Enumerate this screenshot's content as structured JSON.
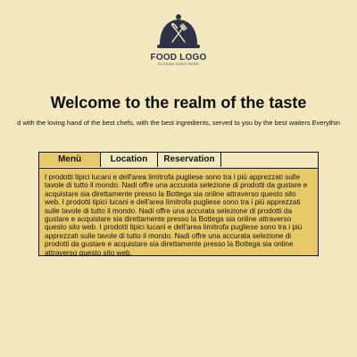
{
  "logo": {
    "title": "FOOD LOGO",
    "slogan": "SLOGAN GOES HERE",
    "icon": "cloche-fork-knife-icon",
    "color": "#2d3248"
  },
  "header": {
    "title": "Welcome to the realm of the taste",
    "tagline": "d with the loving hand of the best chefs, with the best ingredients, served to you by the best waiters Everythin"
  },
  "tabs": [
    {
      "label": "Menù",
      "active": true
    },
    {
      "label": "Location",
      "active": false
    },
    {
      "label": "Reservation",
      "active": false
    }
  ],
  "content": {
    "text": "I prodotti tipici lucani e dell'area limitrofa pugliese sono tra i più apprezzati sulle tavole di tutto il mondo. Nadi offre una accurata selezione di prodotti da gustare e acquistare sia direttamente presso la Bottega sia online attraverso questo sito web. I prodotti tipici lucani e dell'area limitrofa pugliese sono tra i più apprezzati sulle tavole di tutto il mondo. Nadi offre una accurata selezione di prodotti da gustare e acquistare sia direttamente presso la Bottega sia online attraverso questo sito web. I prodotti tipici lucani e dell'area limitrofa pugliese sono tra i più apprezzati sulle tavole di tutto il mondo. Nadi offre una accurata selezione di prodotti da gustare e acquistare sia direttamente presso la Bottega sia online attraverso questo sito web."
  },
  "colors": {
    "background": "#f3e7bd",
    "panel": "#e8c96a",
    "text": "#111111"
  }
}
